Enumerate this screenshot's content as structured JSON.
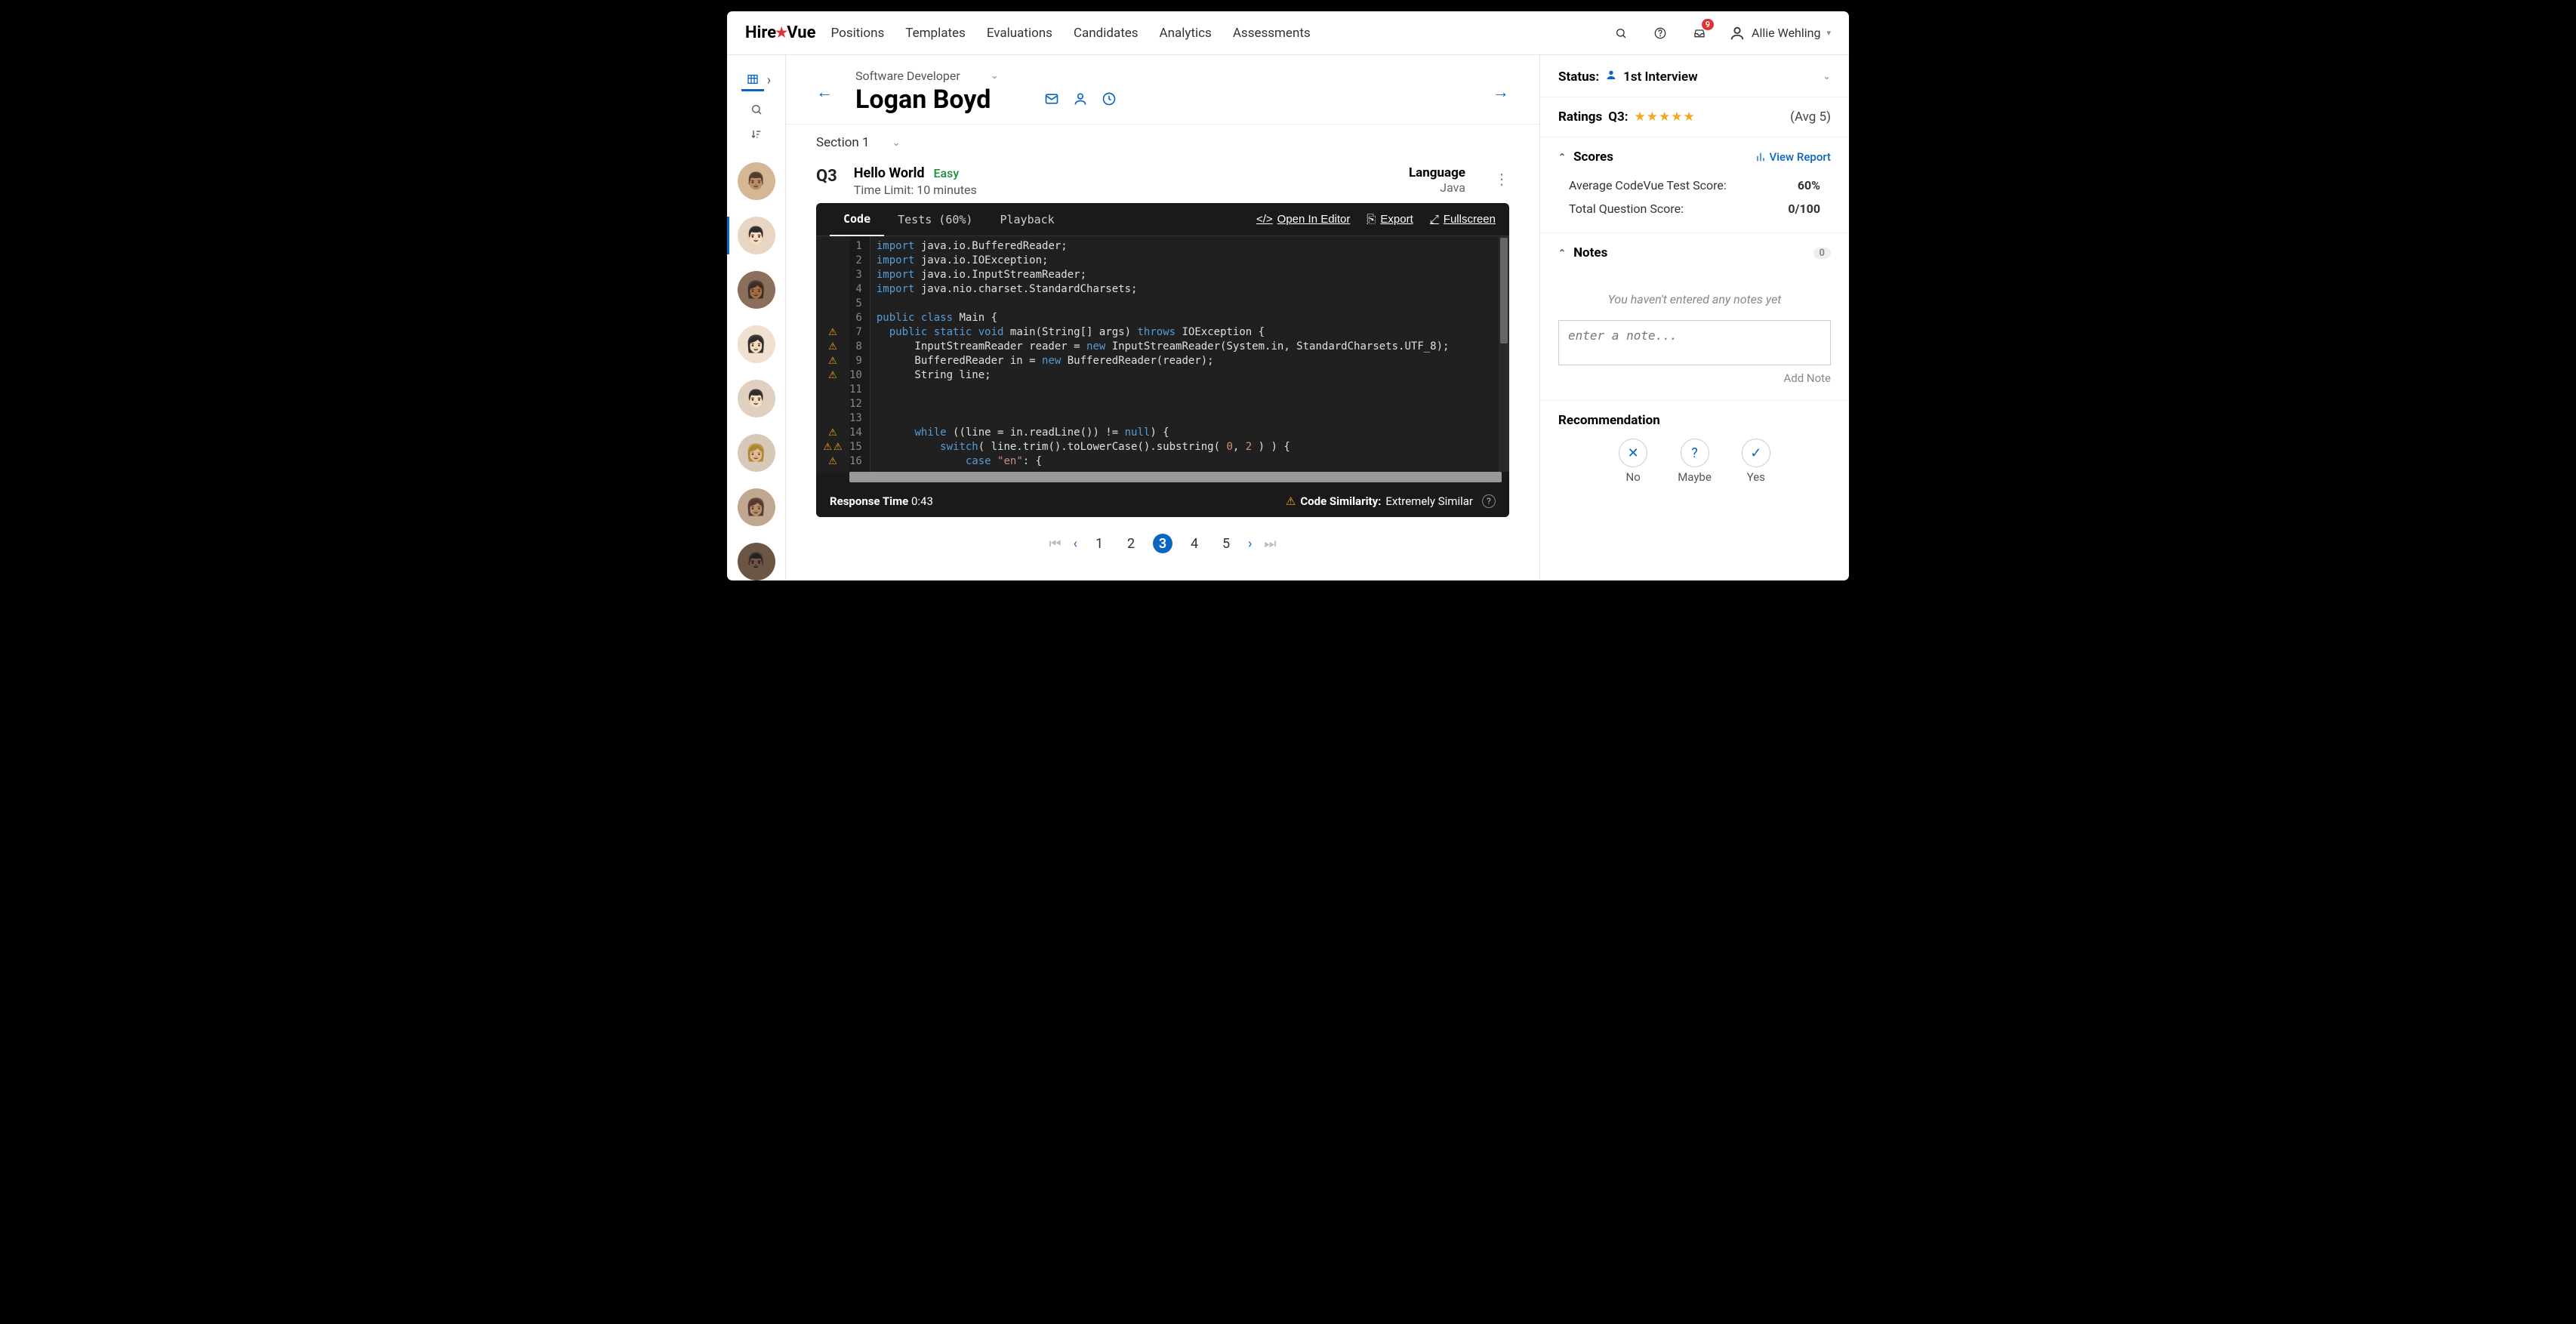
{
  "brand": {
    "pre": "Hire",
    "post": "Vue"
  },
  "nav": [
    "Positions",
    "Templates",
    "Evaluations",
    "Candidates",
    "Analytics",
    "Assessments"
  ],
  "topbar": {
    "notif_count": "9",
    "user_name": "Allie Wehling"
  },
  "candidate": {
    "position": "Software Developer",
    "name": "Logan Boyd",
    "section": "Section 1"
  },
  "question": {
    "num": "Q3",
    "title": "Hello World",
    "difficulty": "Easy",
    "time_limit": "Time Limit: 10 minutes",
    "lang_label": "Language",
    "lang_value": "Java"
  },
  "code_tabs": {
    "code": "Code",
    "tests": "Tests (60%)",
    "playback": "Playback",
    "open": "Open In Editor",
    "export": "Export",
    "fullscreen": "Fullscreen"
  },
  "code_lines": [
    {
      "n": 1,
      "w": 0,
      "html": "<span class='kw'>import</span> java.io.BufferedReader;"
    },
    {
      "n": 2,
      "w": 0,
      "html": "<span class='kw'>import</span> java.io.IOException;"
    },
    {
      "n": 3,
      "w": 0,
      "html": "<span class='kw'>import</span> java.io.InputStreamReader;"
    },
    {
      "n": 4,
      "w": 0,
      "html": "<span class='kw'>import</span> java.nio.charset.StandardCharsets;"
    },
    {
      "n": 5,
      "w": 0,
      "html": ""
    },
    {
      "n": 6,
      "w": 0,
      "html": "<span class='kw'>public</span> <span class='kw'>class</span> Main {"
    },
    {
      "n": 7,
      "w": 1,
      "html": "  <span class='kw'>public</span> <span class='kw'>static</span> <span class='kw'>void</span> main(String[] args) <span class='kw'>throws</span> IOException {"
    },
    {
      "n": 8,
      "w": 1,
      "html": "      InputStreamReader reader = <span class='kw'>new</span> InputStreamReader(System.in, StandardCharsets.UTF_8);"
    },
    {
      "n": 9,
      "w": 1,
      "html": "      BufferedReader in = <span class='kw'>new</span> BufferedReader(reader);"
    },
    {
      "n": 10,
      "w": 1,
      "html": "      String line;"
    },
    {
      "n": 11,
      "w": 0,
      "html": ""
    },
    {
      "n": 12,
      "w": 0,
      "html": ""
    },
    {
      "n": 13,
      "w": 0,
      "html": ""
    },
    {
      "n": 14,
      "w": 1,
      "html": "      <span class='kw'>while</span> ((line = in.readLine()) != <span class='kw'>null</span>) {"
    },
    {
      "n": 15,
      "w": 2,
      "html": "          <span class='kw'>switch</span>( line.trim().toLowerCase().substring( <span class='num2'>0</span>, <span class='num2'>2</span> ) ) {"
    },
    {
      "n": 16,
      "w": 1,
      "html": "              <span class='kw'>case</span> <span class='str'>\"en\"</span>: {"
    }
  ],
  "code_footer": {
    "resp_label": "Response Time",
    "resp_val": "0:43",
    "sim_label": "Code Similarity:",
    "sim_val": "Extremely Similar"
  },
  "pager": {
    "pages": [
      "1",
      "2",
      "3",
      "4",
      "5"
    ],
    "active": "3"
  },
  "rpanel": {
    "status_label": "Status:",
    "status_value": "1st Interview",
    "ratings_label": "Ratings",
    "ratings_q": "Q3:",
    "ratings_avg": "(Avg 5)",
    "scores_label": "Scores",
    "view_report": "View Report",
    "score_rows": [
      {
        "k": "Average CodeVue Test Score:",
        "v": "60%"
      },
      {
        "k": "Total Question Score:",
        "v": "0/100"
      }
    ],
    "notes_label": "Notes",
    "notes_count": "0",
    "notes_empty": "You haven't entered any notes yet",
    "note_placeholder": "enter a note...",
    "add_note": "Add Note",
    "rec_label": "Recommendation",
    "rec": {
      "no": "No",
      "maybe": "Maybe",
      "yes": "Yes"
    }
  }
}
